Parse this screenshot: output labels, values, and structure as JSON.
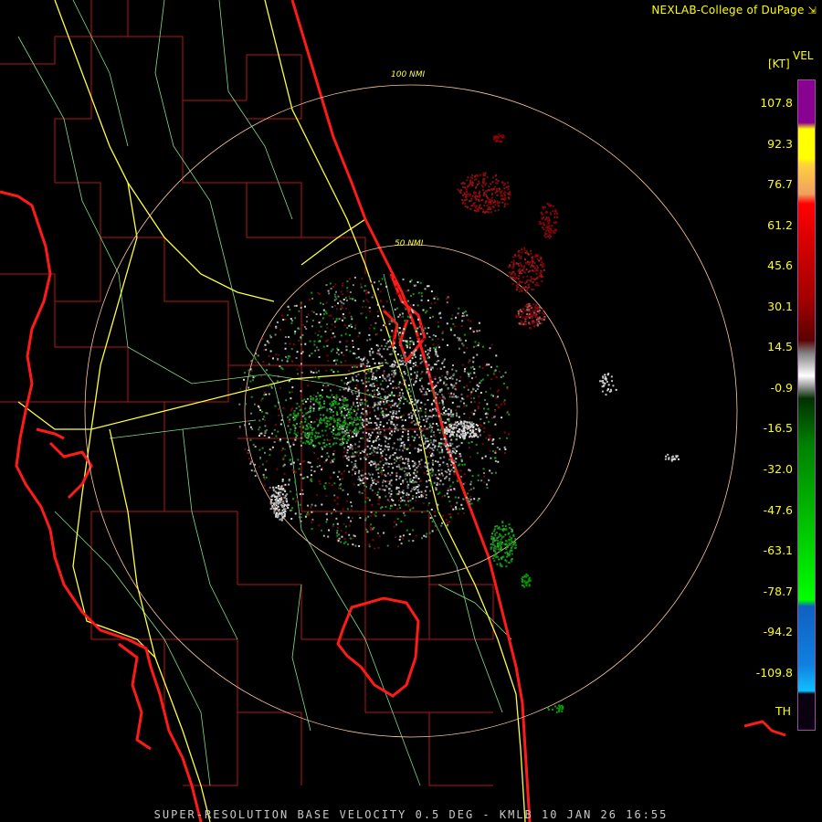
{
  "credit": "NEXLAB-College of DuPage",
  "footer": "SUPER-RESOLUTION BASE VELOCITY 0.5 DEG - KMLB 10 JAN 26 16:55",
  "legend": {
    "product": "VEL",
    "unit": "[KT]",
    "th_label": "TH",
    "ticks": [
      "107.8",
      "92.3",
      "76.7",
      "61.2",
      "45.6",
      "30.1",
      "14.5",
      "-0.9",
      "-16.5",
      "-32.0",
      "-47.6",
      "-63.1",
      "-78.7",
      "-94.2",
      "-109.8"
    ]
  },
  "range_rings": {
    "inner": "50 NMI",
    "outer": "100 NMI"
  },
  "colors": {
    "state_border": "#ff1a1a",
    "county_line": "#b01818",
    "highway": "#ffff40",
    "road": "#80e080",
    "ring": "#ffc8a0",
    "inbound_green": "#00a000",
    "outbound_red": "#8b0000",
    "near_zero": "#b0b0b0"
  }
}
